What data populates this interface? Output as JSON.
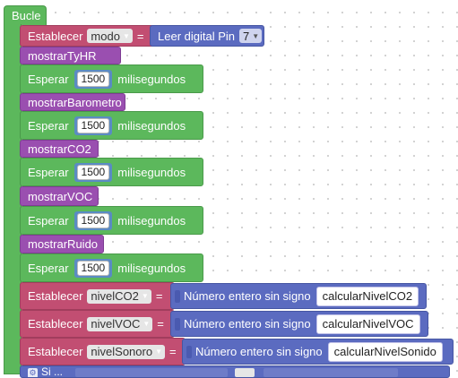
{
  "loop": {
    "label": "Bucle"
  },
  "set_mode": {
    "label": "Establecer",
    "variable": "modo",
    "equals": "=",
    "value_label": "Leer digital Pin",
    "pin": "7"
  },
  "blocks": [
    {
      "name": "mostrarTyHR"
    },
    {
      "wait_label": "Esperar",
      "value": "1500",
      "unit": "milisegundos"
    },
    {
      "name": "mostrarBarometro"
    },
    {
      "wait_label": "Esperar",
      "value": "1500",
      "unit": "milisegundos"
    },
    {
      "name": "mostrarCO2"
    },
    {
      "wait_label": "Esperar",
      "value": "1500",
      "unit": "milisegundos"
    },
    {
      "name": "mostrarVOC"
    },
    {
      "wait_label": "Esperar",
      "value": "1500",
      "unit": "milisegundos"
    },
    {
      "name": "mostrarRuido"
    },
    {
      "wait_label": "Esperar",
      "value": "1500",
      "unit": "milisegundos"
    }
  ],
  "assigns": [
    {
      "label": "Establecer",
      "variable": "nivelCO2",
      "equals": "=",
      "type_label": "Número entero sin signo",
      "function": "calcularNivelCO2"
    },
    {
      "label": "Establecer",
      "variable": "nivelVOC",
      "equals": "=",
      "type_label": "Número entero sin signo",
      "function": "calcularNivelVOC"
    },
    {
      "label": "Establecer",
      "variable": "nivelSonoro",
      "equals": "=",
      "type_label": "Número entero sin signo",
      "function": "calcularNivelSonido"
    }
  ],
  "footer": {
    "label": "Si ..."
  },
  "colors": {
    "loop": "#5cb85c",
    "procedure": "#9a4fb0",
    "wait": "#5cb85c",
    "variable": "#c24e72",
    "cast": "#5b6bc0"
  }
}
